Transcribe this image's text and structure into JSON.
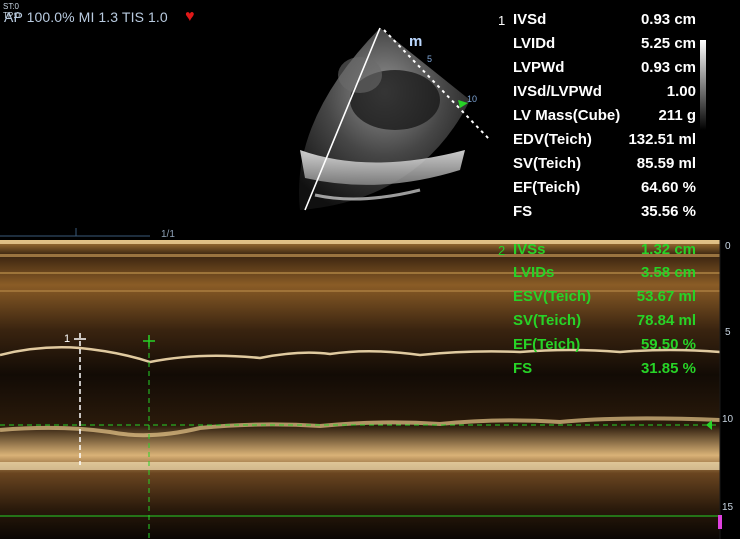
{
  "header": {
    "st_line1": "ST:0",
    "st_line2": "TP:0",
    "status": "AP 100.0%  MI 1.3  TIS 1.0",
    "heart_icon": "heart-icon"
  },
  "sector": {
    "mode_icon_label": "m",
    "depth_marks": [
      "5",
      "10"
    ]
  },
  "mmode": {
    "page_indicator": "1/1",
    "depth_scale": [
      "0",
      "5",
      "10",
      "15"
    ],
    "caliper_label": "1"
  },
  "measurements_1": {
    "index": "1",
    "color": "#ffffff",
    "rows": [
      {
        "label": "IVSd",
        "value": "0.93 cm"
      },
      {
        "label": "LVIDd",
        "value": "5.25 cm"
      },
      {
        "label": "LVPWd",
        "value": "0.93 cm"
      },
      {
        "label": "IVSd/LVPWd",
        "value": "1.00"
      },
      {
        "label": "LV Mass(Cube)",
        "value": "211 g"
      },
      {
        "label": "EDV(Teich)",
        "value": "132.51 ml"
      },
      {
        "label": "SV(Teich)",
        "value": "85.59 ml"
      },
      {
        "label": "EF(Teich)",
        "value": "64.60 %"
      },
      {
        "label": "FS",
        "value": "35.56 %"
      }
    ]
  },
  "measurements_2": {
    "index": "2",
    "color": "#27d327",
    "rows": [
      {
        "label": "IVSs",
        "value": "1.32 cm"
      },
      {
        "label": "LVIDs",
        "value": "3.58 cm"
      },
      {
        "label": "ESV(Teich)",
        "value": "53.67 ml"
      },
      {
        "label": "SV(Teich)",
        "value": "78.84 ml"
      },
      {
        "label": "EF(Teich)",
        "value": "59.50 %"
      },
      {
        "label": "FS",
        "value": "31.85 %"
      }
    ]
  },
  "colors": {
    "caliper_green": "#27d327",
    "heart": "#e01818",
    "mmode_tint": "#c89a52"
  }
}
